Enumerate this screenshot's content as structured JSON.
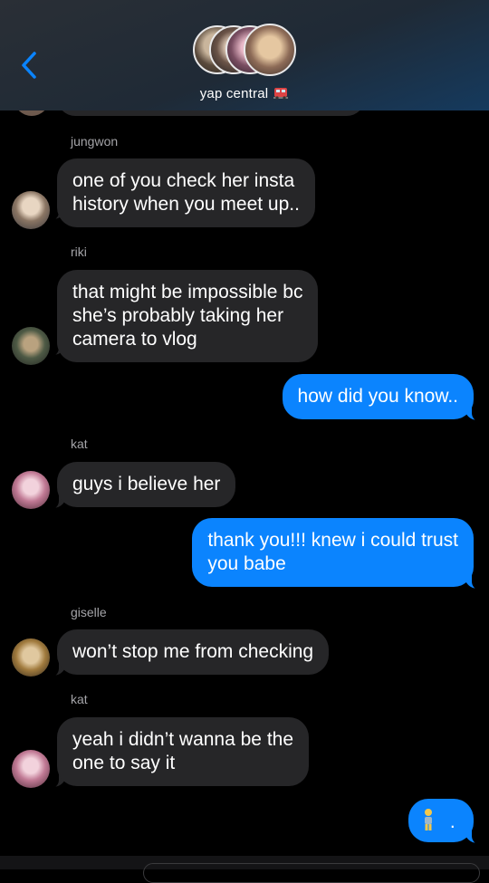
{
  "header": {
    "title": "yap central",
    "title_emoji": "train-emoji",
    "back_icon": "chevron-left-icon"
  },
  "colors": {
    "outgoing": "#0b84fe",
    "incoming": "#262628",
    "background": "#000000",
    "sender_label": "#a4a4a8"
  },
  "messages": [
    {
      "sender": "jungwon",
      "text_lines": [
        "one of you check her insta",
        "history when you meet up.."
      ],
      "direction": "in"
    },
    {
      "sender": "riki",
      "text_lines": [
        "that might be impossible bc",
        "she’s probably taking her",
        "camera to vlog"
      ],
      "direction": "in"
    },
    {
      "text_lines": [
        "how did you know.."
      ],
      "direction": "out"
    },
    {
      "sender": "kat",
      "text_lines": [
        "guys i believe her"
      ],
      "direction": "in"
    },
    {
      "text_lines": [
        "thank you!!! knew i could trust",
        "you babe"
      ],
      "direction": "out"
    },
    {
      "sender": "giselle",
      "text_lines": [
        "won’t stop me from checking"
      ],
      "direction": "in"
    },
    {
      "sender": "kat",
      "text_lines": [
        "yeah i didn’t wanna be the",
        "one to say it"
      ],
      "direction": "in"
    },
    {
      "text": ".",
      "emoji": "person-emoji",
      "direction": "out"
    }
  ]
}
